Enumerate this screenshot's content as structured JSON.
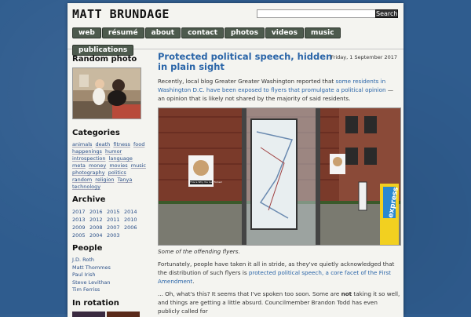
{
  "header": {
    "title": "MATT BRUNDAGE",
    "search_value": "",
    "search_button": "Search"
  },
  "nav": [
    "web",
    "résumé",
    "about",
    "contact",
    "photos",
    "videos",
    "music",
    "publications"
  ],
  "sidebar": {
    "random_photo_heading": "Random photo",
    "categories_heading": "Categories",
    "categories": [
      "animals",
      "death",
      "fitness",
      "food",
      "happenings",
      "humor",
      "introspection",
      "language",
      "meta",
      "money",
      "movies",
      "music",
      "photography",
      "politics",
      "random",
      "religion",
      "Tanya",
      "technology"
    ],
    "archive_heading": "Archive",
    "years": [
      "2017",
      "2016",
      "2015",
      "2014",
      "2013",
      "2012",
      "2011",
      "2010",
      "2009",
      "2008",
      "2007",
      "2006",
      "2005",
      "2004",
      "2003"
    ],
    "people_heading": "People",
    "people": [
      "J.D. Roth",
      "Matt Thommes",
      "Paul Irish",
      "Steve Levithan",
      "Tim Ferriss"
    ],
    "rotation_heading": "In rotation"
  },
  "post": {
    "date": "Friday, 1 September 2017",
    "title": "Protected political speech, hidden in plain sight",
    "p1_pre": "Recently, local blog Greater Greater Washington reported that ",
    "p1_link": "some residents in Washington D.C. have been exposed to flyers that promulgate a political opinion",
    "p1_post": " — an opinion that is likely not shared by the majority of said residents.",
    "photo_poster_text": "This is Why You Get Turned",
    "photo_express_text": "express",
    "caption": "Some of the offending flyers.",
    "p2_pre": "Fortunately, people have taken it all in stride, as they've quietly acknowledged that the distribution of such flyers is ",
    "p2_link": "protected political speech, a core facet of the First Amendment",
    "p2_post": ".",
    "p3_pre": "... Oh, what's this? It seems that I've spoken too soon. Some are ",
    "p3_bold": "not",
    "p3_post": " taking it so well, and things are getting a little absurd. Councilmember Brandon Todd has even publicly called for"
  },
  "colors": {
    "background": "#2f5c8e",
    "link": "#2a65a8",
    "nav_button": "#4d5a4d"
  }
}
